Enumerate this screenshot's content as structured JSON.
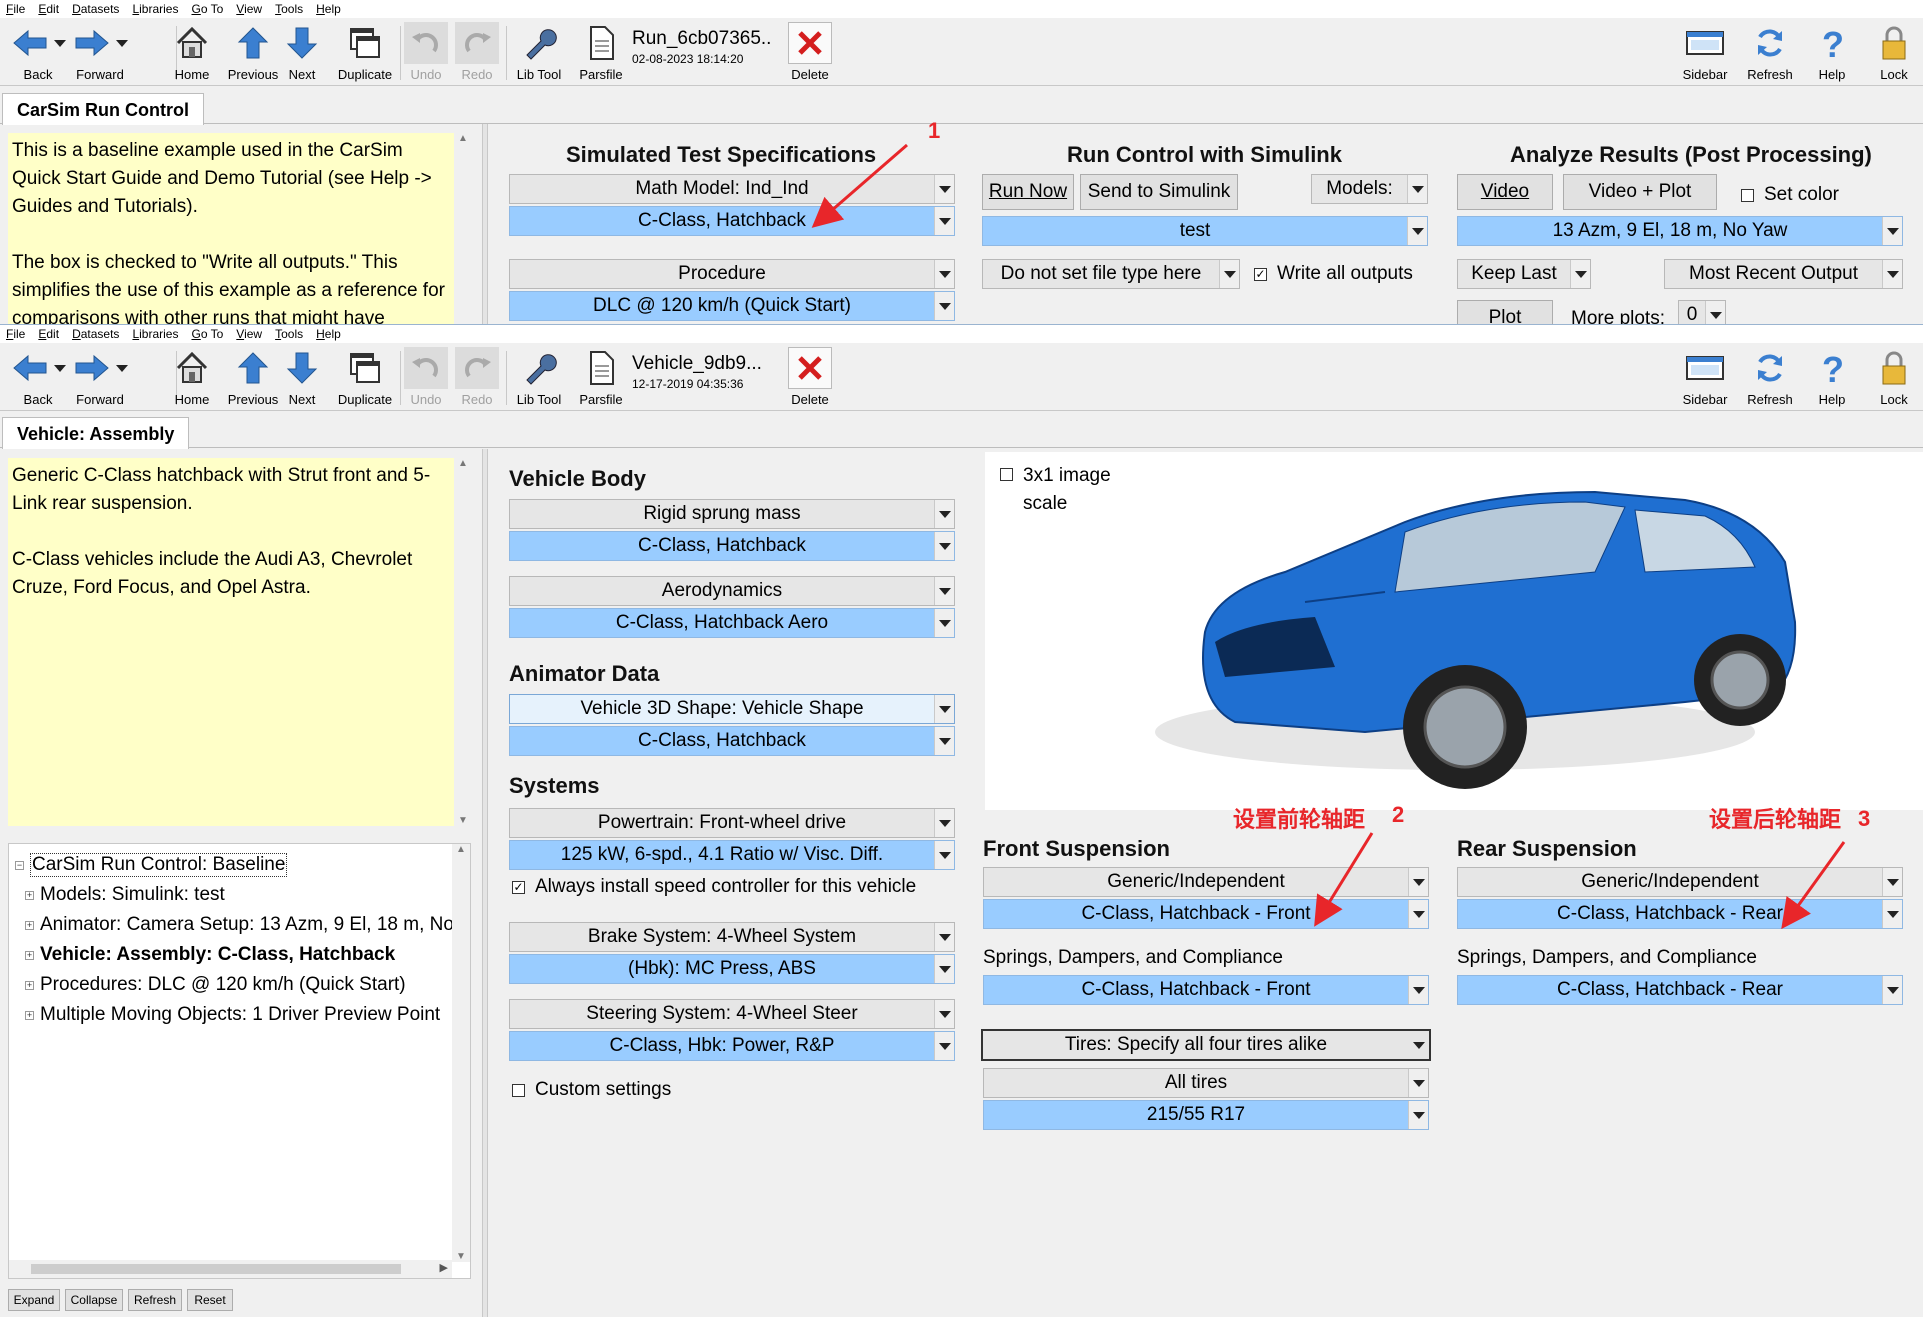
{
  "menu": [
    "File",
    "Edit",
    "Datasets",
    "Libraries",
    "Go To",
    "View",
    "Tools",
    "Help"
  ],
  "toolbar": {
    "back": "Back",
    "forward": "Forward",
    "home": "Home",
    "previous": "Previous",
    "next": "Next",
    "duplicate": "Duplicate",
    "undo": "Undo",
    "redo": "Redo",
    "libtool": "Lib Tool",
    "parsfile": "Parsfile",
    "delete": "Delete",
    "sidebar": "Sidebar",
    "refresh": "Refresh",
    "help": "Help",
    "lock": "Lock"
  },
  "top": {
    "dataset_name": "Run_6cb07365..",
    "dataset_date": "02-08-2023 18:14:20",
    "tab": "CarSim Run Control",
    "notes": [
      "This is a baseline example used in the CarSim Quick Start Guide and Demo Tutorial (see Help -> Guides and Tutorials).",
      "The box is checked to \"Write all outputs.\" This simplifies the use of this example as a reference for comparisons with other runs that might have"
    ],
    "sts_header": "Simulated Test Specifications",
    "math_model": "Math Model: Ind_Ind",
    "vehicle": "C-Class, Hatchback",
    "procedure": "Procedure",
    "procedure_val": "DLC @ 120 km/h (Quick Start)",
    "rc_header": "Run Control with Simulink",
    "run_now": "Run Now",
    "send_simulink": "Send to Simulink",
    "models": "Models:",
    "model_val": "test",
    "file_type": "Do not set file type here",
    "write_all": "Write all outputs",
    "ar_header": "Analyze Results (Post Processing)",
    "video": "Video",
    "video_plot": "Video + Plot",
    "set_color": "Set color",
    "camera": "13 Azm, 9 El, 18 m, No Yaw",
    "keep_last": "Keep Last",
    "recent_output": "Most Recent Output",
    "plot": "Plot",
    "more_plots": "More plots:",
    "more_plots_val": "0"
  },
  "bottom": {
    "dataset_name": "Vehicle_9db9...",
    "dataset_date": "12-17-2019 04:35:36",
    "tab": "Vehicle: Assembly",
    "notes": [
      "Generic C-Class hatchback with Strut front and 5-Link rear suspension.",
      "C-Class vehicles include the Audi A3, Chevrolet Cruze, Ford Focus, and Opel Astra."
    ],
    "tree": [
      {
        "label": "CarSim Run Control: Baseline",
        "bold": false,
        "root": true
      },
      {
        "label": "Models: Simulink: test",
        "bold": false
      },
      {
        "label": "Animator: Camera Setup: 13 Azm, 9 El, 18 m, No",
        "bold": false
      },
      {
        "label": "Vehicle: Assembly: C-Class, Hatchback",
        "bold": true
      },
      {
        "label": "Procedures: DLC @ 120 km/h (Quick Start)",
        "bold": false
      },
      {
        "label": "Multiple Moving Objects: 1 Driver Preview Point",
        "bold": false
      }
    ],
    "tree_buttons": [
      "Expand",
      "Collapse",
      "Refresh",
      "Reset"
    ],
    "vehicle_body": "Vehicle Body",
    "rigid_sprung": "Rigid sprung mass",
    "rigid_sprung_val": "C-Class, Hatchback",
    "aero": "Aerodynamics",
    "aero_val": "C-Class, Hatchback Aero",
    "animator_data": "Animator Data",
    "shape": "Vehicle 3D Shape: Vehicle Shape",
    "shape_val": "C-Class, Hatchback",
    "systems": "Systems",
    "powertrain": "Powertrain: Front-wheel drive",
    "powertrain_val": "125 kW, 6-spd., 4.1 Ratio w/ Visc. Diff.",
    "speed_ctrl": "Always install speed controller for this vehicle",
    "brake": "Brake System: 4-Wheel System",
    "brake_val": "(Hbk): MC Press, ABS",
    "steering": "Steering System: 4-Wheel Steer",
    "steering_val": "C-Class, Hbk: Power, R&P",
    "custom": "Custom settings",
    "scale_label": "3x1 image scale",
    "front_susp": "Front Suspension",
    "front_type": "Generic/Independent",
    "front_val": "C-Class, Hatchback - Front",
    "front_sdc": "Springs, Dampers, and Compliance",
    "front_sdc_val": "C-Class, Hatchback - Front",
    "rear_susp": "Rear Suspension",
    "rear_type": "Generic/Independent",
    "rear_val": "C-Class, Hatchback - Rear",
    "rear_sdc": "Springs, Dampers, and Compliance",
    "rear_sdc_val": "C-Class, Hatchback - Rear",
    "tires": "Tires: Specify all four tires alike",
    "all_tires": "All tires",
    "tire_val": "215/55 R17"
  },
  "annotations": {
    "a1": "1",
    "a2": "设置前轮轴距",
    "a2n": "2",
    "a3": "设置后轮轴距",
    "a3n": "3"
  },
  "colors": {
    "selected_blue": "#99ccff",
    "notes_bg": "#ffffc8",
    "annotation_red": "#e8262a",
    "car_blue": "#1f6fd1"
  }
}
